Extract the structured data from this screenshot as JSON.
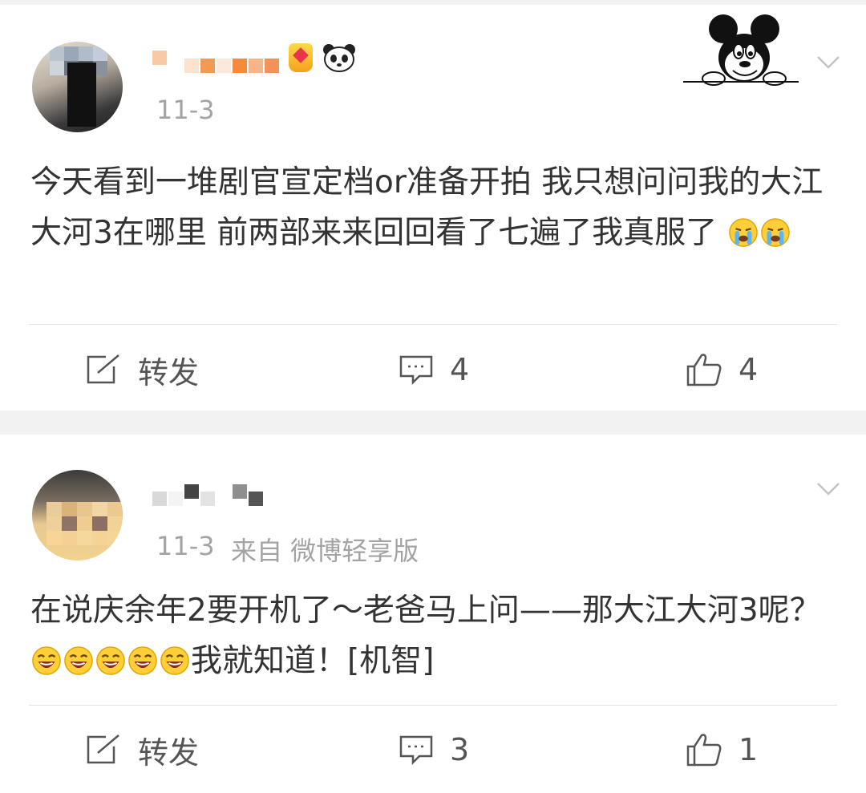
{
  "posts": [
    {
      "timestamp": "11-3",
      "source": "",
      "content_text": "今天看到一堆剧官宣定档or准备开拍 我只想问问我的大江大河3在哪里 前两部来来回回看了七遍了我真服了",
      "content_emojis": [
        "crying-face-emoji",
        "crying-face-emoji"
      ],
      "actions": {
        "repost_label": "转发",
        "comment_count": "4",
        "like_count": "4"
      }
    },
    {
      "timestamp": "11-3",
      "source": "来自 微博轻享版",
      "content_text": "在说庆余年2要开机了～老爸马上问——那大江大河3呢？",
      "content_emojis": [
        "laughing-face-emoji",
        "laughing-face-emoji",
        "laughing-face-emoji",
        "laughing-face-emoji",
        "laughing-face-emoji"
      ],
      "content_tail": "我就知道！[机智]",
      "actions": {
        "repost_label": "转发",
        "comment_count": "3",
        "like_count": "1"
      }
    }
  ],
  "icons": {
    "repost": "repost-icon",
    "comment": "comment-icon",
    "like": "thumbs-up-icon",
    "more": "chevron-down-icon",
    "vip_badge": "vip-badge-icon",
    "panda": "panda-icon",
    "mickey": "mickey-sticker-icon"
  },
  "colors": {
    "page_bg": "#f2f2f2",
    "card_bg": "#ffffff",
    "meta_text": "#a3a3a3",
    "body_text": "#333333"
  }
}
